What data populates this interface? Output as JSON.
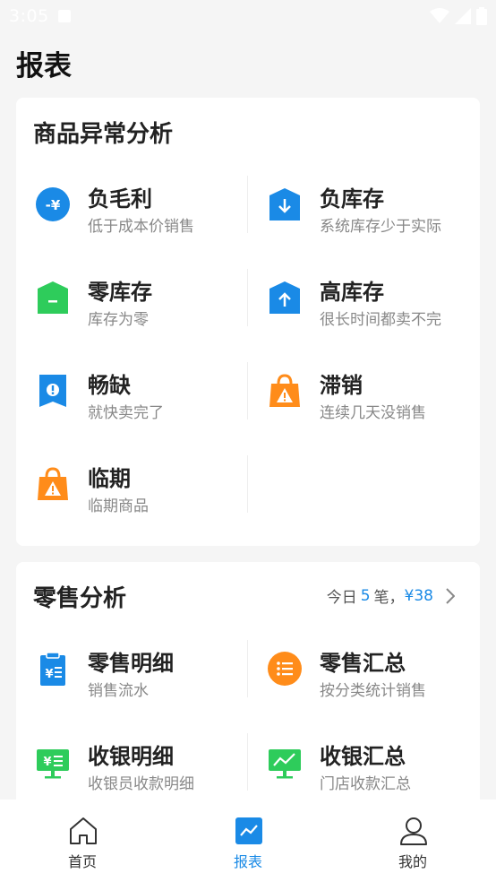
{
  "status_bar": {
    "time": "3:05"
  },
  "page": {
    "title": "报表"
  },
  "anomaly": {
    "title": "商品异常分析",
    "items": [
      {
        "name": "负毛利",
        "desc": "低于成本价销售",
        "icon": "negative-yen-icon",
        "color": "#1a8ae6"
      },
      {
        "name": "负库存",
        "desc": "系统库存少于实际",
        "icon": "box-down-icon",
        "color": "#1a8ae6"
      },
      {
        "name": "零库存",
        "desc": "库存为零",
        "icon": "box-zero-icon",
        "color": "#2ecc5b"
      },
      {
        "name": "高库存",
        "desc": "很长时间都卖不完",
        "icon": "box-up-icon",
        "color": "#1a8ae6"
      },
      {
        "name": "畅缺",
        "desc": "就快卖完了",
        "icon": "alert-tag-icon",
        "color": "#1a8ae6"
      },
      {
        "name": "滞销",
        "desc": "连续几天没销售",
        "icon": "warning-bag-icon",
        "color": "#ff8c1a"
      },
      {
        "name": "临期",
        "desc": "临期商品",
        "icon": "warning-bag-icon",
        "color": "#ff8c1a"
      }
    ]
  },
  "retail": {
    "title": "零售分析",
    "summary_prefix": "今日",
    "summary_count": "5",
    "summary_mid": "笔，",
    "summary_amount": "¥38",
    "items": [
      {
        "name": "零售明细",
        "desc": "销售流水",
        "icon": "clipboard-yen-icon",
        "color": "#1a8ae6"
      },
      {
        "name": "零售汇总",
        "desc": "按分类统计销售",
        "icon": "list-circle-icon",
        "color": "#ff8c1a"
      },
      {
        "name": "收银明细",
        "desc": "收银员收款明细",
        "icon": "register-yen-icon",
        "color": "#2ecc5b"
      },
      {
        "name": "收银汇总",
        "desc": "门店收款汇总",
        "icon": "register-chart-icon",
        "color": "#2ecc5b"
      }
    ]
  },
  "tabbar": {
    "tabs": [
      {
        "label": "首页",
        "icon": "home-icon"
      },
      {
        "label": "报表",
        "icon": "chart-icon",
        "active": true
      },
      {
        "label": "我的",
        "icon": "user-icon"
      }
    ]
  }
}
